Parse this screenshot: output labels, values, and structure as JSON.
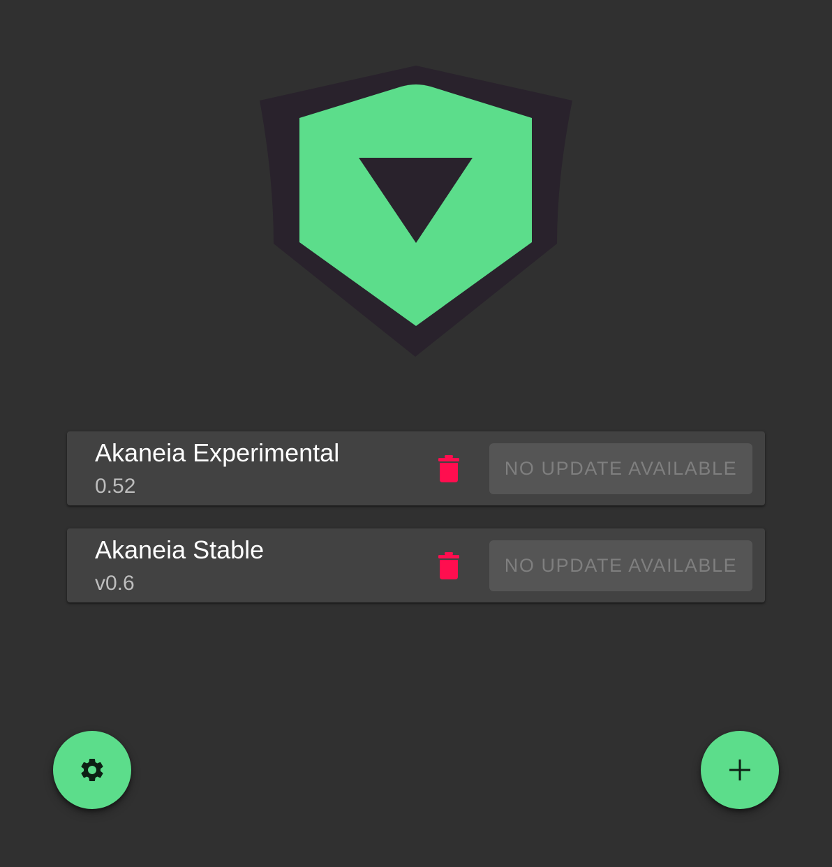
{
  "colors": {
    "background": "#303030",
    "card": "#424242",
    "accent": "#5cdd8b",
    "logo_dark": "#29222c",
    "delete": "#ff0e4f",
    "button_disabled_bg": "#555555",
    "button_disabled_text": "#7f7f7f"
  },
  "logo": {
    "icon": "shield-logo-icon"
  },
  "games": [
    {
      "title": "Akaneia Experimental",
      "version": "0.52",
      "delete_icon": "trash-icon",
      "update_label": "NO UPDATE AVAILABLE"
    },
    {
      "title": "Akaneia Stable",
      "version": "v0.6",
      "delete_icon": "trash-icon",
      "update_label": "NO UPDATE AVAILABLE"
    }
  ],
  "fabs": {
    "settings_icon": "gear-icon",
    "add_icon": "plus-icon"
  }
}
